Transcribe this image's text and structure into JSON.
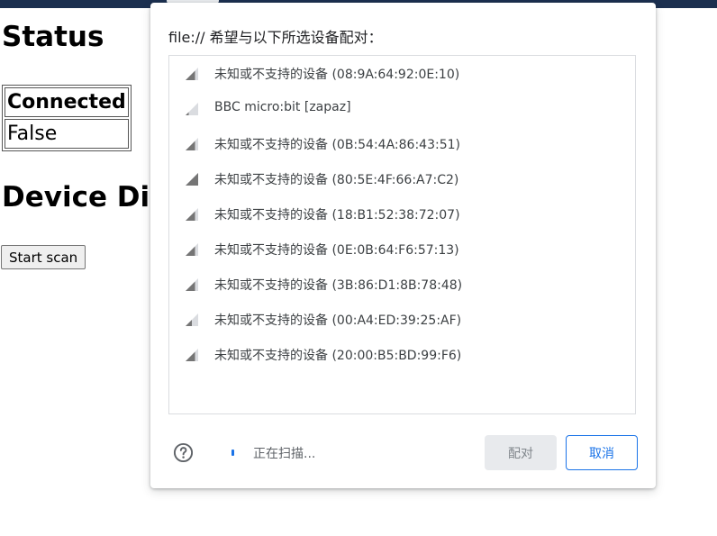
{
  "page": {
    "status_heading": "Status",
    "table": {
      "header": "Connected",
      "value": "False"
    },
    "device_heading": "Device Discovery",
    "scan_button": "Start scan"
  },
  "dialog": {
    "title": "file:// 希望与以下所选设备配对：",
    "devices": [
      {
        "label": "未知或不支持的设备 (08:9A:64:92:0E:10)",
        "signal": 3
      },
      {
        "label": "BBC micro:bit [zapaz]",
        "signal": 1
      },
      {
        "label": "未知或不支持的设备 (0B:54:4A:86:43:51)",
        "signal": 3
      },
      {
        "label": "未知或不支持的设备 (80:5E:4F:66:A7:C2)",
        "signal": 4
      },
      {
        "label": "未知或不支持的设备 (18:B1:52:38:72:07)",
        "signal": 3
      },
      {
        "label": "未知或不支持的设备 (0E:0B:64:F6:57:13)",
        "signal": 3
      },
      {
        "label": "未知或不支持的设备 (3B:86:D1:8B:78:48)",
        "signal": 3
      },
      {
        "label": "未知或不支持的设备 (00:A4:ED:39:25:AF)",
        "signal": 2
      },
      {
        "label": "未知或不支持的设备 (20:00:B5:BD:99:F6)",
        "signal": 3
      }
    ],
    "scan_status": "正在扫描...",
    "pair_button": "配对",
    "cancel_button": "取消",
    "help_icon": "help-circle-icon"
  },
  "colors": {
    "accent": "#1a73e8",
    "top_bar": "#1b2f4f",
    "disabled_button_bg": "#e8eaed"
  }
}
